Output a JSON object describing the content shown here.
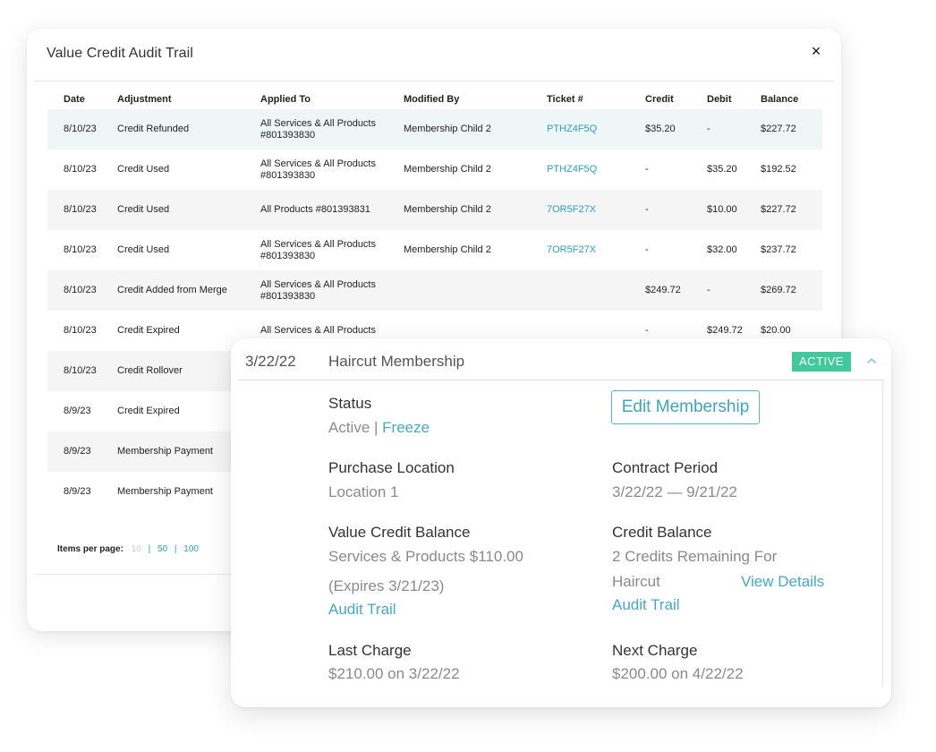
{
  "audit_modal": {
    "title": "Value Credit Audit Trail",
    "close_label": "×",
    "columns": [
      "Date",
      "Adjustment",
      "Applied To",
      "Modified By",
      "Ticket #",
      "Credit",
      "Debit",
      "Balance"
    ],
    "rows": [
      {
        "date": "8/10/23",
        "adjustment": "Credit Refunded",
        "applied_to": [
          "All Services & All Products",
          "#801393830"
        ],
        "modified_by": "Membership Child 2",
        "ticket": "PTHZ4F5Q",
        "credit": "$35.20",
        "debit": "-",
        "balance": "$227.72"
      },
      {
        "date": "8/10/23",
        "adjustment": "Credit Used",
        "applied_to": [
          "All Services & All Products",
          "#801393830"
        ],
        "modified_by": "Membership Child 2",
        "ticket": "PTHZ4F5Q",
        "credit": "-",
        "debit": "$35.20",
        "balance": "$192.52"
      },
      {
        "date": "8/10/23",
        "adjustment": "Credit Used",
        "applied_to": [
          "All Products #801393831"
        ],
        "modified_by": "Membership Child 2",
        "ticket": "7OR5F27X",
        "credit": "-",
        "debit": "$10.00",
        "balance": "$227.72"
      },
      {
        "date": "8/10/23",
        "adjustment": "Credit Used",
        "applied_to": [
          "All Services & All Products",
          "#801393830"
        ],
        "modified_by": "Membership Child 2",
        "ticket": "7OR5F27X",
        "credit": "-",
        "debit": "$32.00",
        "balance": "$237.72"
      },
      {
        "date": "8/10/23",
        "adjustment": "Credit Added from Merge",
        "applied_to": [
          "All Services & All Products",
          "#801393830"
        ],
        "modified_by": "",
        "ticket": "",
        "credit": "$249.72",
        "debit": "-",
        "balance": "$269.72"
      },
      {
        "date": "8/10/23",
        "adjustment": "Credit Expired",
        "applied_to": [
          "All Services & All Products"
        ],
        "modified_by": "",
        "ticket": "",
        "credit": "-",
        "debit": "$249.72",
        "balance": "$20.00"
      },
      {
        "date": "8/10/23",
        "adjustment": "Credit Rollover",
        "applied_to": [],
        "modified_by": "",
        "ticket": "",
        "credit": "",
        "debit": "",
        "balance": ""
      },
      {
        "date": "8/9/23",
        "adjustment": "Credit Expired",
        "applied_to": [],
        "modified_by": "",
        "ticket": "",
        "credit": "",
        "debit": "",
        "balance": ""
      },
      {
        "date": "8/9/23",
        "adjustment": "Membership Payment",
        "applied_to": [],
        "modified_by": "",
        "ticket": "",
        "credit": "",
        "debit": "",
        "balance": ""
      },
      {
        "date": "8/9/23",
        "adjustment": "Membership Payment",
        "applied_to": [],
        "modified_by": "",
        "ticket": "",
        "credit": "",
        "debit": "",
        "balance": ""
      }
    ],
    "pagination": {
      "label": "Items per page:",
      "current": "10",
      "options": [
        "50",
        "100"
      ],
      "separator": "|"
    }
  },
  "membership_card": {
    "date": "3/22/22",
    "name": "Haircut Membership",
    "badge": "ACTIVE",
    "edit_button": "Edit Membership",
    "status": {
      "label": "Status",
      "value": "Active |",
      "link": "Freeze"
    },
    "purchase_location": {
      "label": "Purchase Location",
      "value": "Location 1"
    },
    "contract_period": {
      "label": "Contract Period",
      "value": "3/22/22 — 9/21/22"
    },
    "value_credit_balance": {
      "label": "Value Credit Balance",
      "line1": "Services & Products $110.00",
      "line2": "(Expires 3/21/23)",
      "link": "Audit Trail"
    },
    "credit_balance": {
      "label": "Credit Balance",
      "line1": "2 Credits Remaining For",
      "line2": "Haircut",
      "details_link": "View Details",
      "link": "Audit Trail"
    },
    "last_charge": {
      "label": "Last Charge",
      "value": "$210.00 on 3/22/22"
    },
    "next_charge": {
      "label": "Next Charge",
      "value": "$200.00 on 4/22/22"
    }
  },
  "colors": {
    "accent": "#48a8c4",
    "badge_green": "#41c99b",
    "row_highlight": "#eef6f8",
    "row_stripe": "#f5f5f5"
  },
  "icons": {
    "close": "close-icon",
    "collapse": "chevron-up-icon"
  }
}
